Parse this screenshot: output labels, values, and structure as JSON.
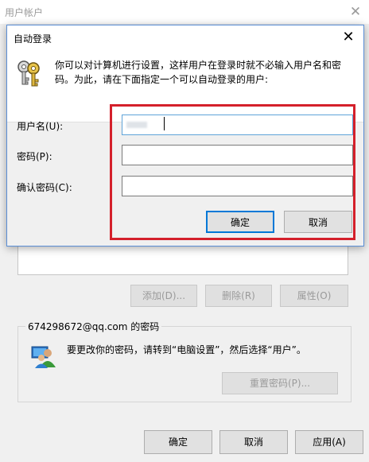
{
  "background_window": {
    "title": "用户帐户",
    "close_glyph": "✕",
    "buttons": {
      "add": "添加(D)...",
      "remove": "删除(R)",
      "properties": "属性(O)"
    },
    "password_group": {
      "legend": "674298672@qq.com 的密码",
      "message": "要更改你的密码，请转到“电脑设置”，然后选择“用户”。",
      "reset_button": "重置密码(P)..."
    },
    "footer": {
      "ok": "确定",
      "cancel": "取消",
      "apply": "应用(A)"
    }
  },
  "dialog": {
    "title": "自动登录",
    "close_glyph": "✕",
    "description": "你可以对计算机进行设置，这样用户在登录时就不必输入用户名和密码。为此，请在下面指定一个可以自动登录的用户:",
    "fields": {
      "username_label": "用户名(U):",
      "password_label": "密码(P):",
      "confirm_label": "确认密码(C):",
      "password_value": "",
      "confirm_value": ""
    },
    "buttons": {
      "ok": "确定",
      "cancel": "取消"
    }
  },
  "colors": {
    "highlight": "#d4202b",
    "dialog_border": "#5a8ed6",
    "focus": "#0078d7"
  }
}
